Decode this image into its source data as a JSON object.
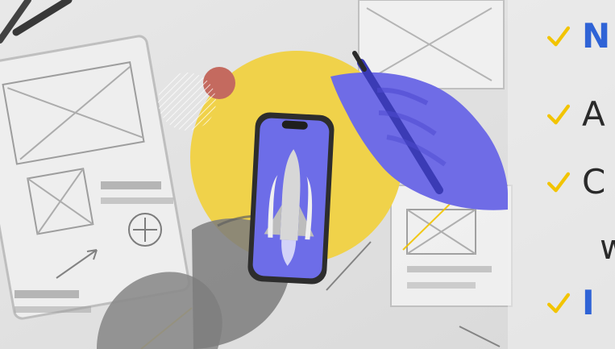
{
  "colors": {
    "accent": "#2f63d6",
    "check": "#f2c400",
    "circle": "#f0d24a",
    "hand": "#6f6ce6",
    "screen": "#6d6de8"
  },
  "checklist": [
    {
      "text": "N",
      "style": "accent"
    },
    {
      "text": "A",
      "style": "dark"
    },
    {
      "text": "C",
      "style": "dark"
    },
    {
      "text": "w",
      "style": "dark",
      "check": false
    },
    {
      "text": "I",
      "style": "accent"
    }
  ],
  "icons": {
    "check": "checkmark-icon"
  }
}
